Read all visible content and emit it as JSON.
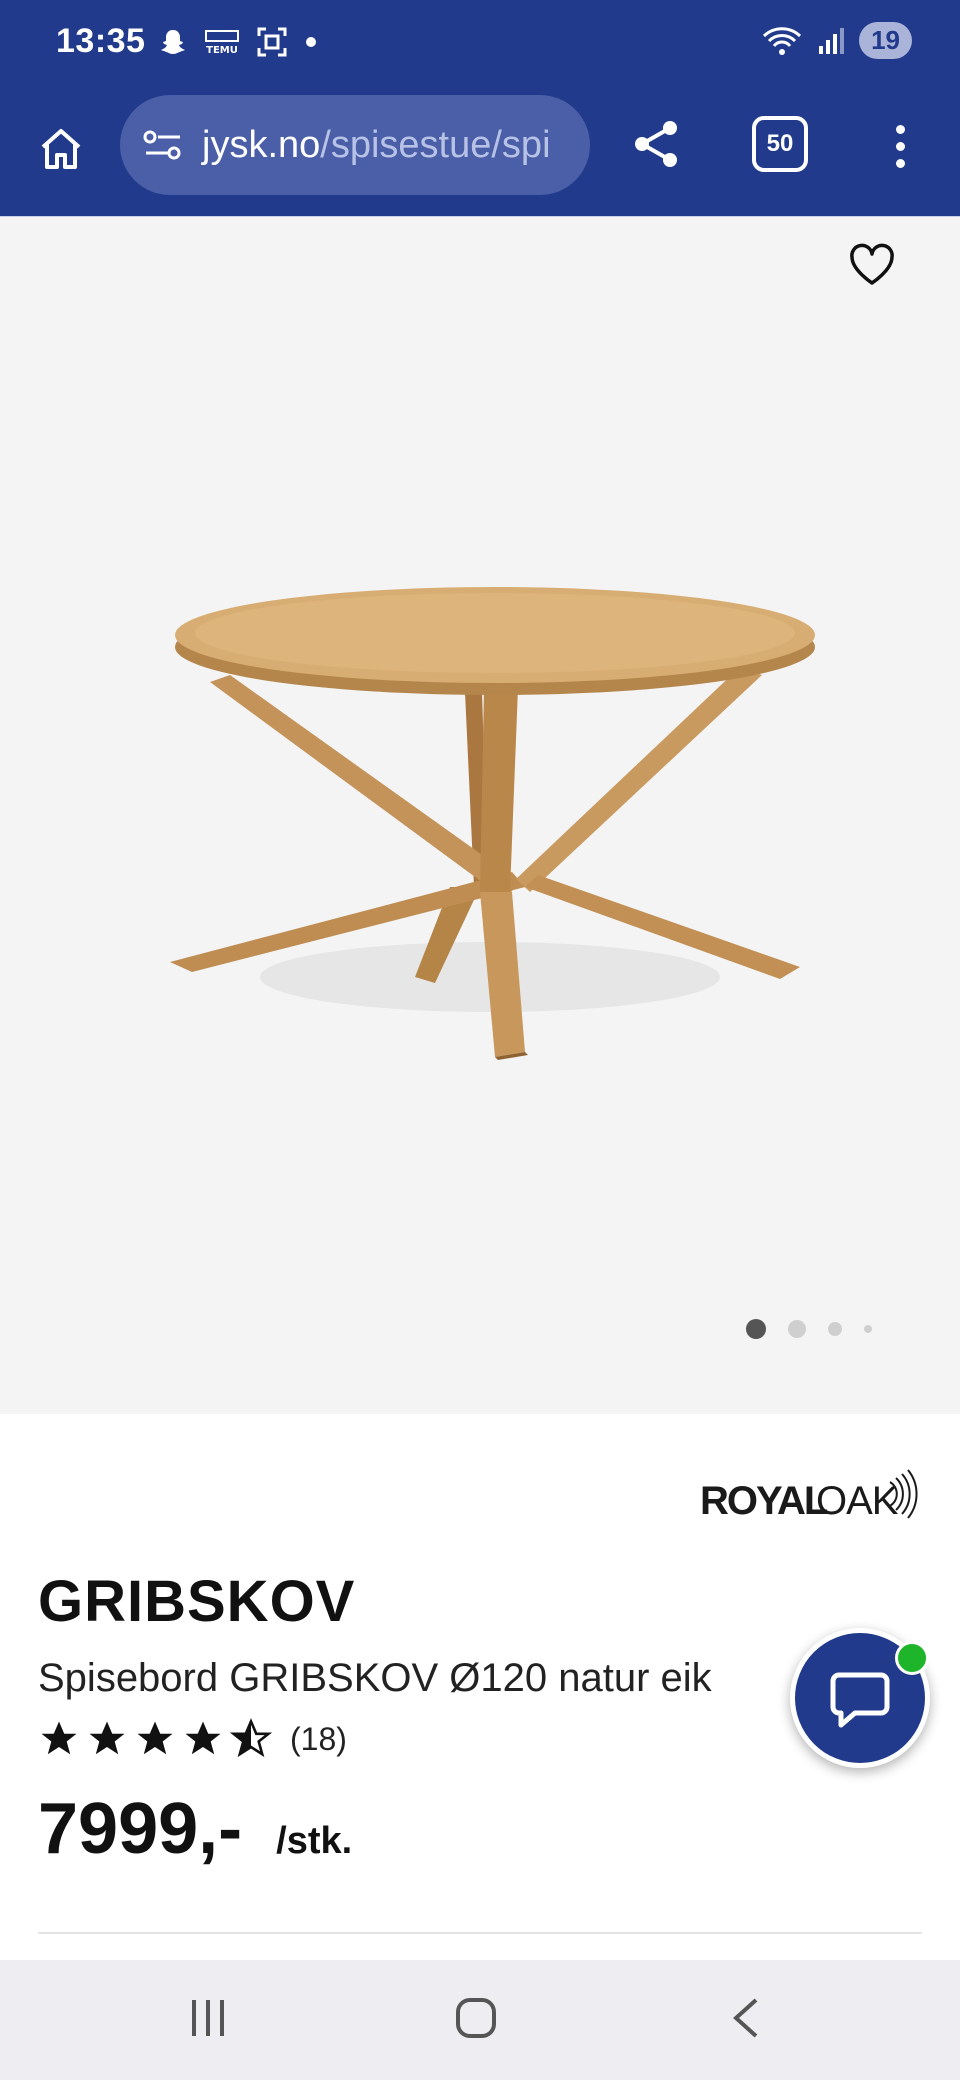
{
  "status_bar": {
    "time": "13:35",
    "battery": "19",
    "left_icons": [
      "snapchat-icon",
      "temu-icon",
      "screenshot-icon",
      "dot-icon"
    ],
    "right_icons": [
      "wifi-icon",
      "signal-icon",
      "battery-icon"
    ]
  },
  "browser": {
    "url_host": "jysk.no",
    "url_path": "/spisestue/spi",
    "tab_count": "50",
    "colors": {
      "bar": "#223a8c",
      "url_field": "#4a5fa8"
    }
  },
  "product": {
    "brand": "ROYAL OAK",
    "name": "GRIBSKOV",
    "description": "Spisebord GRIBSKOV Ø120 natur eik",
    "rating": 4.5,
    "rating_count": "(18)",
    "price": "7999,-",
    "unit": "/stk.",
    "image_count": 4,
    "active_image": 1
  },
  "chat": {
    "online_color": "#1fb52b"
  },
  "nav": {
    "icons": [
      "recent-apps-icon",
      "home-icon",
      "back-icon"
    ]
  }
}
